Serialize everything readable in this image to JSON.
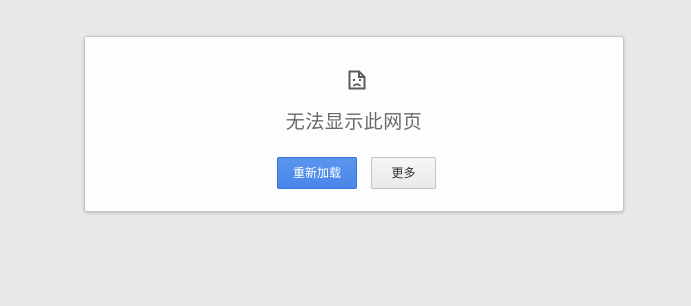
{
  "error_page": {
    "title": "无法显示此网页",
    "icon": "sad-document-icon",
    "buttons": {
      "reload_label": "重新加载",
      "more_label": "更多"
    }
  },
  "colors": {
    "background": "#e8e8e8",
    "card": "#fdfdfd",
    "primary_button": "#4a86e8",
    "title_text": "#6a6a6a"
  }
}
